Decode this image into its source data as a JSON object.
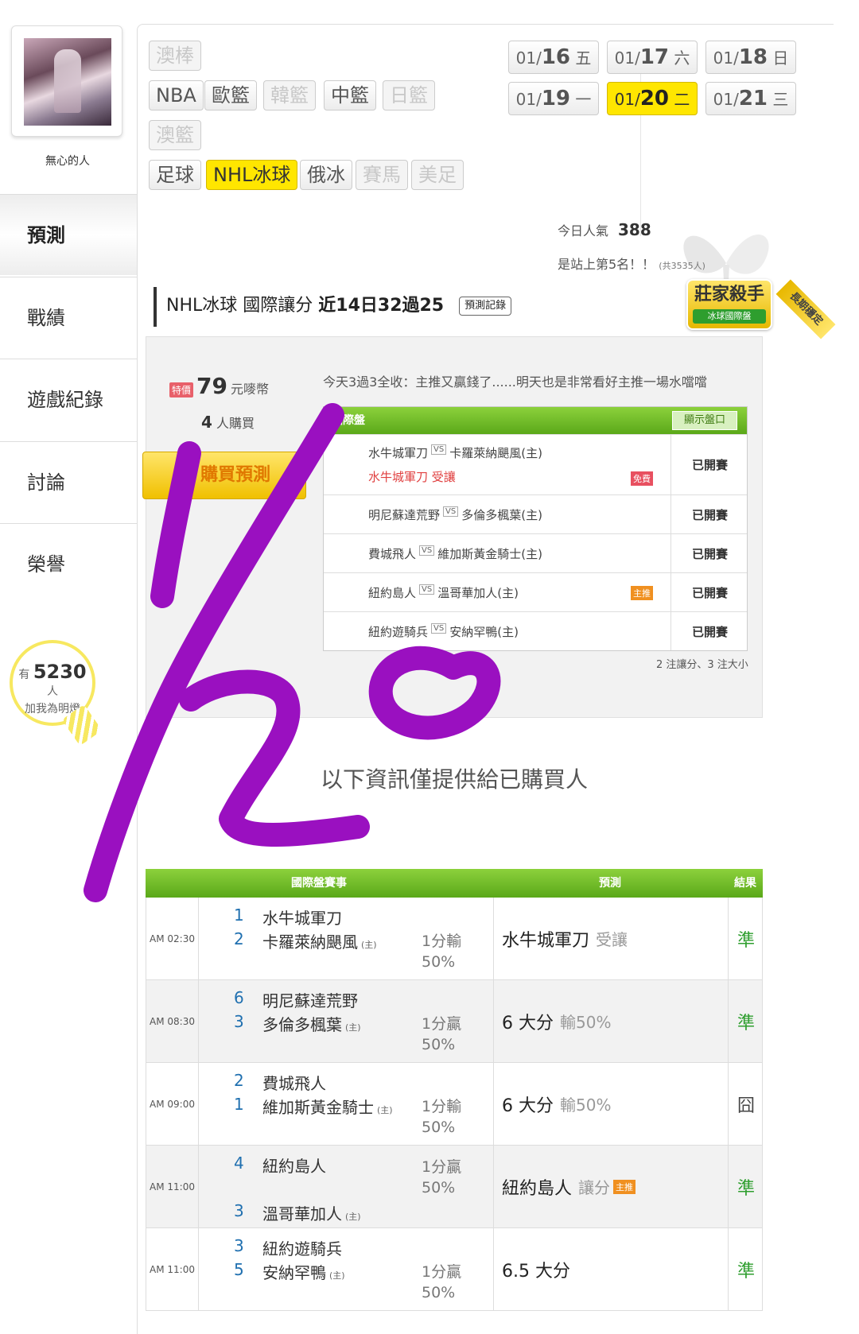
{
  "sidebar": {
    "username": "無心的人",
    "nav": [
      "預測",
      "戰績",
      "遊戲紀錄",
      "討論",
      "榮譽"
    ],
    "active_nav": "預測",
    "bulb": {
      "prefix": "有",
      "count": "5230",
      "suffix": "人",
      "caption": "加我為明燈"
    }
  },
  "sports": {
    "row1": [
      "澳棒"
    ],
    "row2": [
      "NBA",
      "歐籃",
      "韓籃",
      "中籃",
      "日籃"
    ],
    "row3": [
      "澳籃"
    ],
    "row4": [
      "足球",
      "NHL冰球",
      "俄冰",
      "賽馬",
      "美足"
    ],
    "active": "NHL冰球",
    "disabled": [
      "澳棒",
      "韓籃",
      "日籃",
      "澳籃",
      "賽馬",
      "美足"
    ]
  },
  "dates": [
    {
      "md": "01/",
      "d": "16",
      "dow": "五"
    },
    {
      "md": "01/",
      "d": "17",
      "dow": "六"
    },
    {
      "md": "01/",
      "d": "18",
      "dow": "日"
    },
    {
      "md": "01/",
      "d": "19",
      "dow": "一"
    },
    {
      "md": "01/",
      "d": "20",
      "dow": "二",
      "active": true
    },
    {
      "md": "01/",
      "d": "21",
      "dow": "三"
    }
  ],
  "stats": {
    "popularity_label": "今日人氣",
    "popularity_value": "388",
    "rank_text": "是站上第5名！！",
    "rank_total": "(共3535人)"
  },
  "section": {
    "title": "NHL冰球 國際讓分",
    "record": "近14日32過25",
    "record_button": "預測記錄",
    "badge_title": "莊家殺手",
    "badge_sub": "冰球國際盤",
    "badge_ribbon": "長期穩定"
  },
  "purchase": {
    "special_tag": "特價",
    "price": "79",
    "price_unit": "元嘜幣",
    "buyers_count": "4",
    "buyers_label": "人購買",
    "buy_button": "購買預測",
    "note": "今天3過3全收：主推又贏錢了......明天也是非常看好主推一場水噹噹"
  },
  "mini_table": {
    "header": "國際盤",
    "show_button": "顯示盤口",
    "rows": [
      {
        "away": "水牛城軍刀",
        "home": "卡羅萊納颶風(主)",
        "pick": "水牛城軍刀  受讓",
        "tag": "免費",
        "status": "已開賽"
      },
      {
        "away": "明尼蘇達荒野",
        "home": "多倫多楓葉(主)",
        "status": "已開賽"
      },
      {
        "away": "費城飛人",
        "home": "維加斯黃金騎士(主)",
        "status": "已開賽"
      },
      {
        "away": "紐約島人",
        "home": "溫哥華加人(主)",
        "tag": "主推",
        "status": "已開賽"
      },
      {
        "away": "紐約遊騎兵",
        "home": "安納罕鴨(主)",
        "status": "已開賽"
      }
    ],
    "summary": "2 注讓分、3 注大小"
  },
  "buyers_only_text": "以下資訊僅提供給已購買人",
  "big_table": {
    "headers": {
      "match": "國際盤賽事",
      "prediction": "預測",
      "result": "結果"
    },
    "rows": [
      {
        "time": "AM 02:30",
        "n1": "1",
        "t1": "水牛城軍刀",
        "n2": "2",
        "t2": "卡羅萊納颶風",
        "home_tag": "(主)",
        "line1": "1分輸",
        "line2": "50%",
        "pred": "水牛城軍刀",
        "pred_sub": "受讓",
        "result": "準"
      },
      {
        "time": "AM 08:30",
        "n1": "6",
        "t1": "明尼蘇達荒野",
        "n2": "3",
        "t2": "多倫多楓葉",
        "home_tag": "(主)",
        "line1": "1分贏",
        "line2": "50%",
        "pred": "6 大分",
        "pred_sub": "輸50%",
        "result": "準"
      },
      {
        "time": "AM 09:00",
        "n1": "2",
        "t1": "費城飛人",
        "n2": "1",
        "t2": "維加斯黃金騎士",
        "home_tag": "(主)",
        "line1": "1分輸",
        "line2": "50%",
        "pred": "6 大分",
        "pred_sub": "輸50%",
        "result": "囧"
      },
      {
        "time": "AM 11:00",
        "n1": "4",
        "t1": "紐約島人",
        "n2": "3",
        "t2": "溫哥華加人",
        "home_tag": "(主)",
        "line1": "1分贏",
        "line2": "50%",
        "pred": "紐約島人",
        "pred_sub": "讓分",
        "pred_tag": "主推",
        "result": "準"
      },
      {
        "time": "AM 11:00",
        "n1": "3",
        "t1": "紐約遊騎兵",
        "n2": "5",
        "t2": "安納罕鴨",
        "home_tag": "(主)",
        "line1": "1分贏",
        "line2": "50%",
        "pred": "6.5 大分",
        "pred_sub": "",
        "result": "準"
      }
    ]
  },
  "handwriting": "1/20",
  "colors": {
    "accent_green": "#5aa819",
    "highlight_yellow": "#ffe600",
    "win_green": "#2e9e2e",
    "scribble_purple": "#9a10c0"
  }
}
